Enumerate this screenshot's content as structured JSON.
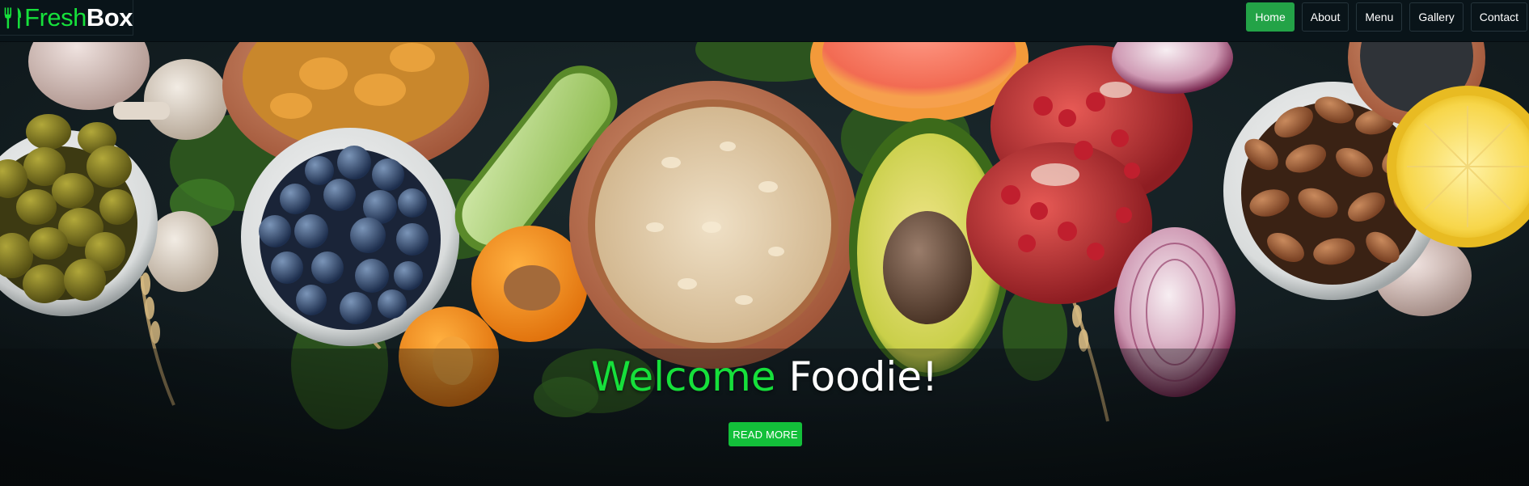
{
  "brand": {
    "part1": "Fresh",
    "part2": "Box",
    "icon": "fork-knife-icon"
  },
  "nav": {
    "items": [
      {
        "label": "Home",
        "active": true
      },
      {
        "label": "About",
        "active": false
      },
      {
        "label": "Menu",
        "active": false
      },
      {
        "label": "Gallery",
        "active": false
      },
      {
        "label": "Contact",
        "active": false
      }
    ]
  },
  "hero": {
    "title_accent": "Welcome",
    "title_rest": "Foodie!",
    "cta_label": "READ MORE"
  },
  "colors": {
    "accent_green": "#16e03b",
    "button_green": "#13c03a",
    "nav_active": "#23a347",
    "navbar_bg": "#091419",
    "hero_bg": "#0b1418"
  }
}
